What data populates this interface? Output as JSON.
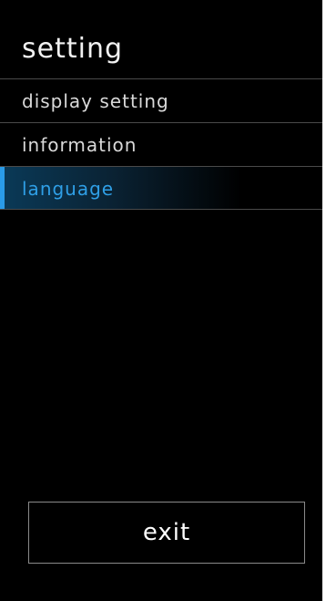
{
  "header": {
    "title": "setting"
  },
  "menu": {
    "items": [
      {
        "label": "display setting"
      },
      {
        "label": "information"
      },
      {
        "label": "language"
      }
    ],
    "selected_index": 2
  },
  "footer": {
    "exit_label": "exit"
  },
  "colors": {
    "background": "#000000",
    "accent": "#2a9be8",
    "text": "#d9d9d9",
    "divider": "#4a4a4a"
  }
}
